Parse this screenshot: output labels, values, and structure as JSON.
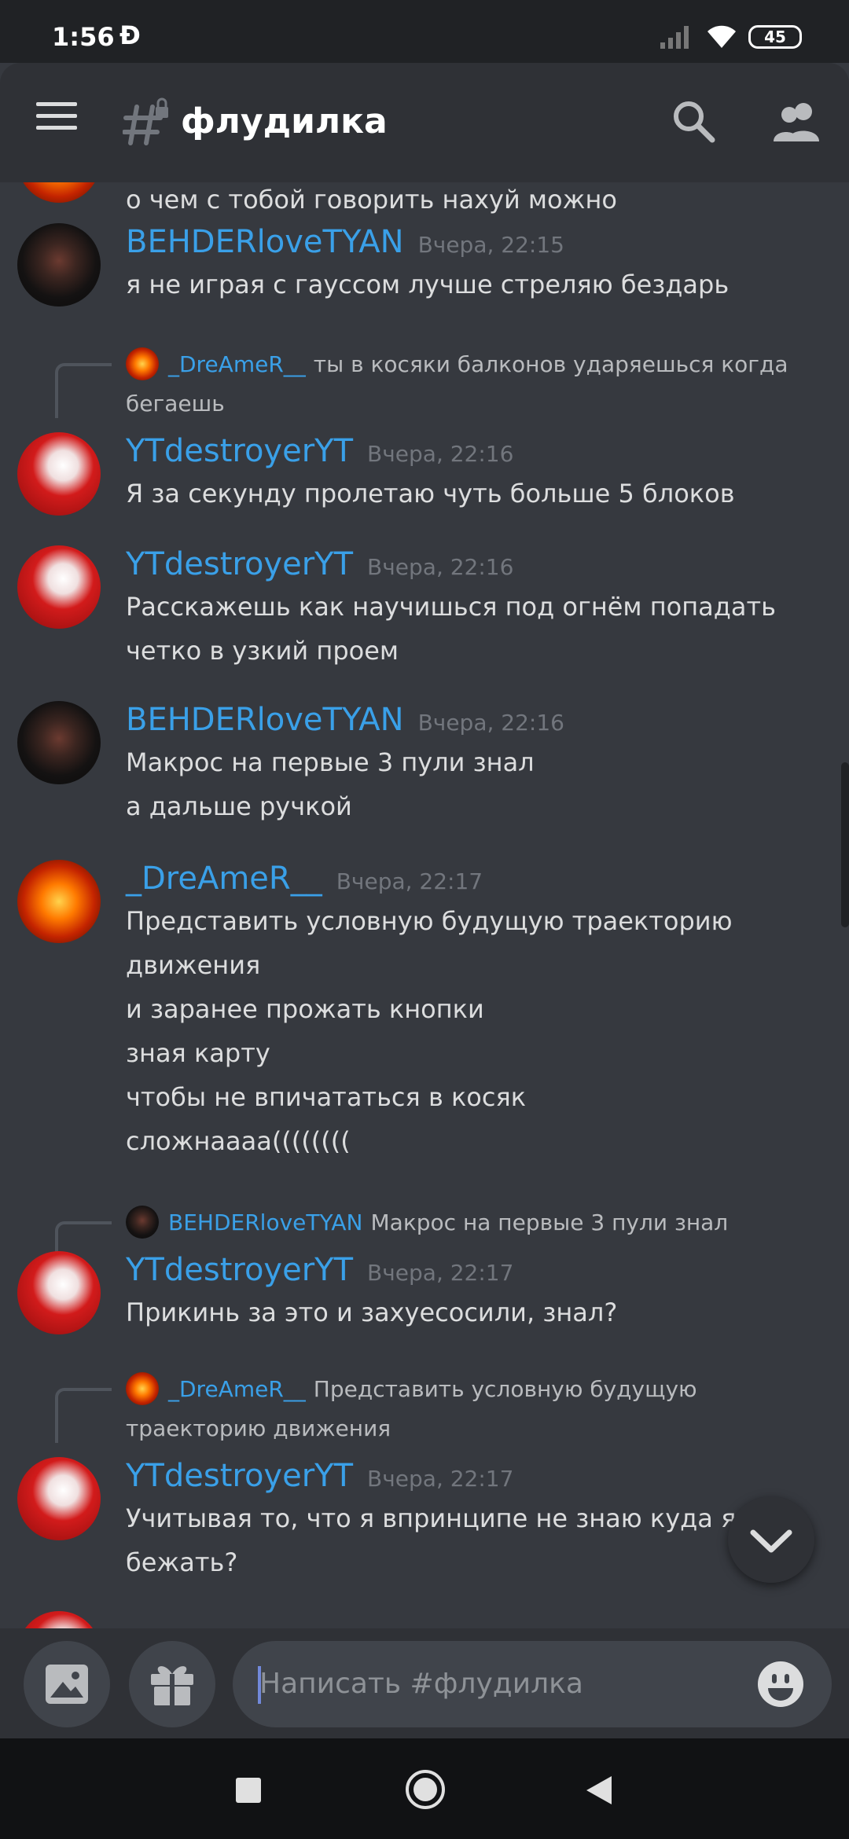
{
  "status": {
    "time": "1:56",
    "app_letter": "Ð",
    "battery": "45"
  },
  "header": {
    "channel": "флудилка"
  },
  "messages": [
    {
      "author": "",
      "time": "",
      "lines": [
        "о чем с тобой говорить нахуй можно"
      ]
    },
    {
      "author": "BEHDERloveTYAN",
      "time": "Вчера, 22:15",
      "lines": [
        "я  не играя с гауссом лучше стреляю бездарь"
      ]
    },
    {
      "reply": {
        "author": "_DreAmeR__",
        "text": "ты в косяки балконов ударяешься когда",
        "text2": "бегаешь"
      },
      "author": "YTdestroyerYT",
      "time": "Вчера, 22:16",
      "lines": [
        "Я за секунду пролетаю чуть больше 5 блоков"
      ]
    },
    {
      "author": "YTdestroyerYT",
      "time": "Вчера, 22:16",
      "lines": [
        "Расскажешь как научишься под огнём попадать",
        "четко в узкий проем"
      ]
    },
    {
      "author": "BEHDERloveTYAN",
      "time": "Вчера, 22:16",
      "lines": [
        "Макрос на первые 3 пули знал",
        "а дальше ручкой"
      ]
    },
    {
      "author": "_DreAmeR__",
      "time": "Вчера, 22:17",
      "lines": [
        "Представить условную будущую траекторию",
        "движения",
        "и заранее прожать кнопки",
        "зная карту",
        "чтобы не впичататься в косяк",
        "сложнаааа(((((((("
      ]
    },
    {
      "reply": {
        "author": "BEHDERloveTYAN",
        "text": "Макрос на первые 3 пули знал",
        "text2": ""
      },
      "author": "YTdestroyerYT",
      "time": "Вчера, 22:17",
      "lines": [
        "Прикинь за это и захуесосили, знал?"
      ]
    },
    {
      "reply": {
        "author": "_DreAmeR__",
        "text": "Представить условную будущую",
        "text2": "траекторию движения"
      },
      "author": "YTdestroyerYT",
      "time": "Вчера, 22:17",
      "lines": [
        "Учитывая то, что я впринципе не знаю куда я б",
        "бежать?"
      ]
    }
  ],
  "composer": {
    "placeholder": "Написать #флудилка"
  },
  "colors": {
    "background": "#36393f",
    "header": "#2f3136",
    "username": "#3aa0e8",
    "text": "#dcddde",
    "timestamp": "#72767d"
  },
  "icons": [
    "menu-icon",
    "channel-hash-lock-icon",
    "search-icon",
    "members-icon",
    "image-icon",
    "gift-icon",
    "emoji-icon",
    "chevron-down-icon"
  ]
}
